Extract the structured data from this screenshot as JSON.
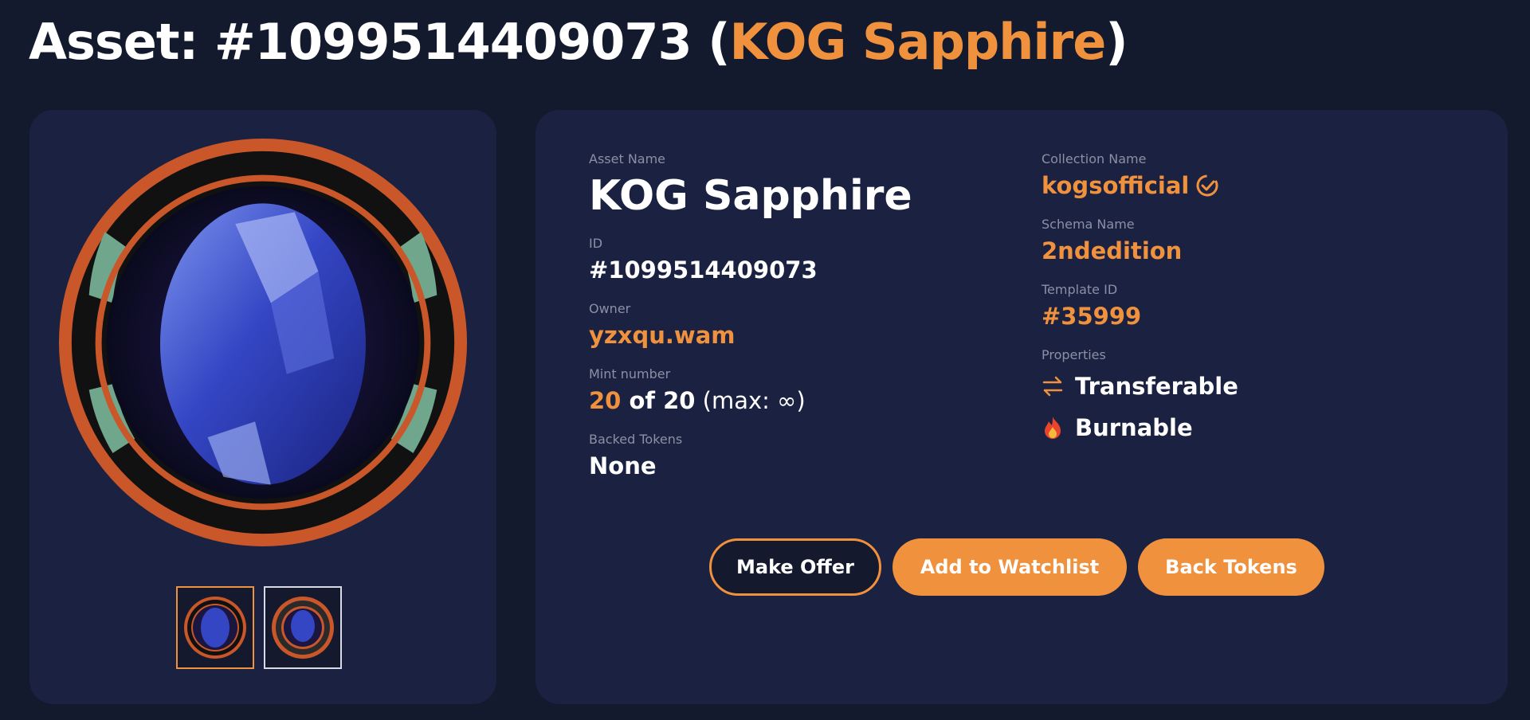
{
  "header": {
    "title_prefix": "Asset: #1099514409073 (",
    "title_name": "KOG Sapphire",
    "title_suffix": ")"
  },
  "asset": {
    "name_label": "Asset Name",
    "name": "KOG Sapphire",
    "id_label": "ID",
    "id": "#1099514409073",
    "owner_label": "Owner",
    "owner": "yzxqu.wam",
    "mint_label": "Mint number",
    "mint_number": "20",
    "mint_of": " of 20",
    "mint_max": " (max: ∞)",
    "backed_label": "Backed Tokens",
    "backed": "None",
    "collection_label": "Collection Name",
    "collection": "kogsofficial",
    "schema_label": "Schema Name",
    "schema": "2ndedition",
    "template_label": "Template ID",
    "template_id": "#35999",
    "properties_label": "Properties",
    "properties": [
      "Transferable",
      "Burnable"
    ]
  },
  "actions": {
    "make_offer": "Make Offer",
    "add_watchlist": "Add to Watchlist",
    "back_tokens": "Back Tokens"
  },
  "icons": {
    "verified": "check-circle-icon",
    "transferable": "arrows-swap-icon",
    "burnable": "fire-icon"
  },
  "colors": {
    "accent": "#f0913e",
    "background": "#141a2e",
    "card": "#1b2140",
    "ring_orange": "#c9572a",
    "ring_green": "#6fa68c"
  }
}
